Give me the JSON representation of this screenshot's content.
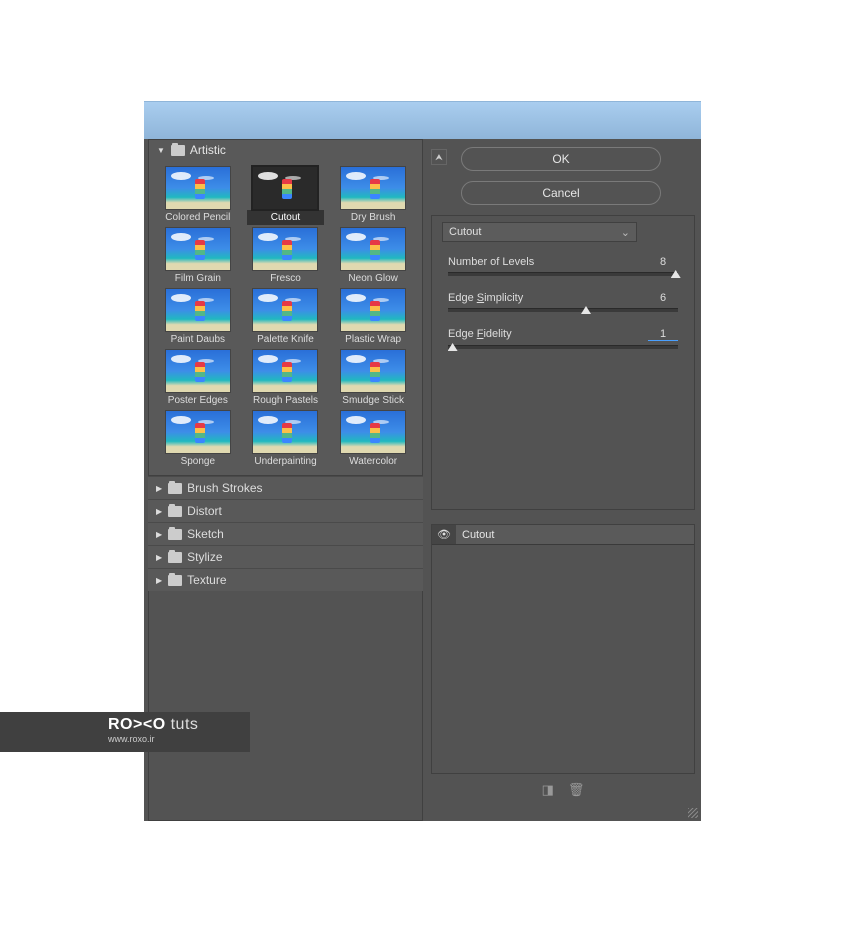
{
  "categories": {
    "artistic": "Artistic",
    "brush_strokes": "Brush Strokes",
    "distort": "Distort",
    "sketch": "Sketch",
    "stylize": "Stylize",
    "texture": "Texture"
  },
  "thumbs": [
    {
      "label": "Colored Pencil"
    },
    {
      "label": "Cutout"
    },
    {
      "label": "Dry Brush"
    },
    {
      "label": "Film Grain"
    },
    {
      "label": "Fresco"
    },
    {
      "label": "Neon Glow"
    },
    {
      "label": "Paint Daubs"
    },
    {
      "label": "Palette Knife"
    },
    {
      "label": "Plastic Wrap"
    },
    {
      "label": "Poster Edges"
    },
    {
      "label": "Rough Pastels"
    },
    {
      "label": "Smudge Stick"
    },
    {
      "label": "Sponge"
    },
    {
      "label": "Underpainting"
    },
    {
      "label": "Watercolor"
    }
  ],
  "buttons": {
    "ok": "OK",
    "cancel": "Cancel"
  },
  "dropdown": {
    "selected": "Cutout"
  },
  "params": {
    "levels_label": "Number of Levels",
    "levels_value": "8",
    "levels_pos_pct": 99,
    "simplicity_label_pre": "Edge ",
    "simplicity_label_u": "S",
    "simplicity_label_post": "implicity",
    "simplicity_value": "6",
    "simplicity_pos_pct": 60,
    "fidelity_label_pre": "Edge ",
    "fidelity_label_u": "F",
    "fidelity_label_post": "idelity",
    "fidelity_value": "1",
    "fidelity_pos_pct": 2
  },
  "layer": {
    "name": "Cutout"
  },
  "watermark": {
    "brand_bold": "RO><O",
    "brand_light": "tuts",
    "url": "www.roxo.ir"
  }
}
